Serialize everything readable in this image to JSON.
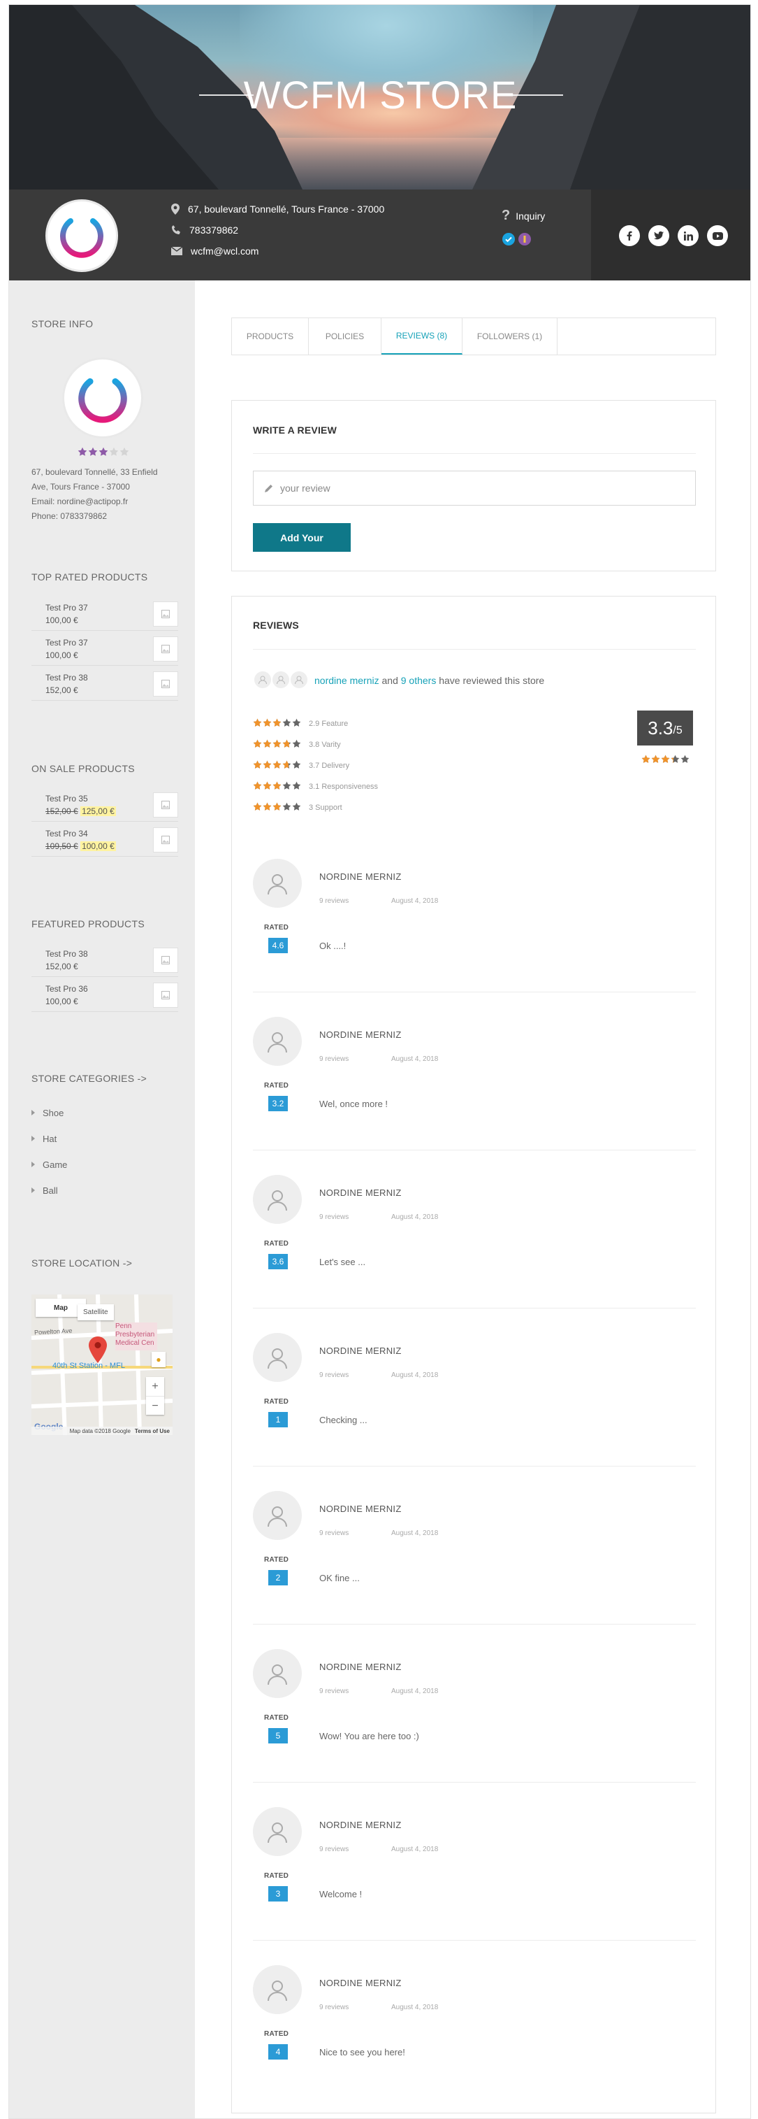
{
  "banner": {
    "title": "WCFM STORE"
  },
  "store_info": {
    "address": "67, boulevard Tonnellé, Tours France - 37000",
    "phone": "783379862",
    "email": "wcfm@wcl.com",
    "inquiry_label": "Inquiry",
    "social": [
      "facebook-icon",
      "twitter-icon",
      "linkedin-icon",
      "youtube-icon"
    ]
  },
  "sidebar": {
    "store_info_title": "STORE INFO",
    "rating_stars": 3,
    "address_line1": "67, boulevard Tonnellé, 33 Enfield",
    "address_line2": "Ave, Tours France - 37000",
    "email_line": "Email: nordine@actipop.fr",
    "phone_line": "Phone: 0783379862",
    "top_rated_title": "TOP RATED PRODUCTS",
    "top_rated": [
      {
        "name": "Test Pro 37",
        "price": "100,00 €"
      },
      {
        "name": "Test Pro 37",
        "price": "100,00 €"
      },
      {
        "name": "Test Pro 38",
        "price": "152,00 €"
      }
    ],
    "on_sale_title": "ON SALE PRODUCTS",
    "on_sale": [
      {
        "name": "Test Pro 35",
        "old_price": "152,00 €",
        "price": "125,00 €"
      },
      {
        "name": "Test Pro 34",
        "old_price": "109,50 €",
        "price": "100,00 €"
      }
    ],
    "featured_title": "FEATURED PRODUCTS",
    "featured": [
      {
        "name": "Test Pro 38",
        "price": "152,00 €"
      },
      {
        "name": "Test Pro 36",
        "price": "100,00 €"
      }
    ],
    "categories_title": "STORE CATEGORIES ->",
    "categories": [
      "Shoe",
      "Hat",
      "Game",
      "Ball"
    ],
    "location_title": "STORE LOCATION ->",
    "map": {
      "tab_map": "Map",
      "tab_satellite": "Satellite",
      "label_street": "Powelton Ave",
      "label_place": "Penn Presbyterian Medical Cen",
      "label_station": "40th St Station - MFL",
      "zoom_in": "+",
      "zoom_out": "−",
      "logo": "Google",
      "attribution": "Map data ©2018 Google",
      "terms": "Terms of Use"
    }
  },
  "tabs": [
    {
      "label": "PRODUCTS"
    },
    {
      "label": "POLICIES"
    },
    {
      "label": "REVIEWS (8)"
    },
    {
      "label": "FOLLOWERS (1)"
    }
  ],
  "write_review": {
    "title": "WRITE A REVIEW",
    "placeholder": "your review",
    "button": "Add Your"
  },
  "reviews": {
    "title": "REVIEWS",
    "reviewer_main": "nordine merniz",
    "and_text": "and",
    "others": "9 others",
    "reviewed_suffix": "have reviewed this store",
    "criteria": [
      {
        "value": 2.9,
        "label": "2.9 Feature"
      },
      {
        "value": 3.8,
        "label": "3.8 Varity"
      },
      {
        "value": 3.7,
        "label": "3.7 Delivery"
      },
      {
        "value": 3.1,
        "label": "3.1 Responsiveness"
      },
      {
        "value": 3.0,
        "label": "3 Support"
      }
    ],
    "average": "3.3",
    "average_suffix": "/5",
    "average_value": 3.3,
    "rated_label": "RATED",
    "items": [
      {
        "name": "NORDINE MERNIZ",
        "count": "9 reviews",
        "date": "August 4, 2018",
        "score": "4.6",
        "text": "Ok ....!"
      },
      {
        "name": "NORDINE MERNIZ",
        "count": "9 reviews",
        "date": "August 4, 2018",
        "score": "3.2",
        "text": "Wel, once more !"
      },
      {
        "name": "NORDINE MERNIZ",
        "count": "9 reviews",
        "date": "August 4, 2018",
        "score": "3.6",
        "text": "Let's see ..."
      },
      {
        "name": "NORDINE MERNIZ",
        "count": "9 reviews",
        "date": "August 4, 2018",
        "score": "1",
        "text": "Checking ..."
      },
      {
        "name": "NORDINE MERNIZ",
        "count": "9 reviews",
        "date": "August 4, 2018",
        "score": "2",
        "text": "OK fine ..."
      },
      {
        "name": "NORDINE MERNIZ",
        "count": "9 reviews",
        "date": "August 4, 2018",
        "score": "5",
        "text": "Wow! You are here too :)"
      },
      {
        "name": "NORDINE MERNIZ",
        "count": "9 reviews",
        "date": "August 4, 2018",
        "score": "3",
        "text": "Welcome !"
      },
      {
        "name": "NORDINE MERNIZ",
        "count": "9 reviews",
        "date": "August 4, 2018",
        "score": "4",
        "text": "Nice to see you here!"
      }
    ]
  },
  "colors": {
    "accent": "#17a2b8",
    "button": "#0f7889",
    "star_orange": "#f0932b",
    "star_purple": "#8e5aa8",
    "score_blue": "#2b9bd6"
  }
}
